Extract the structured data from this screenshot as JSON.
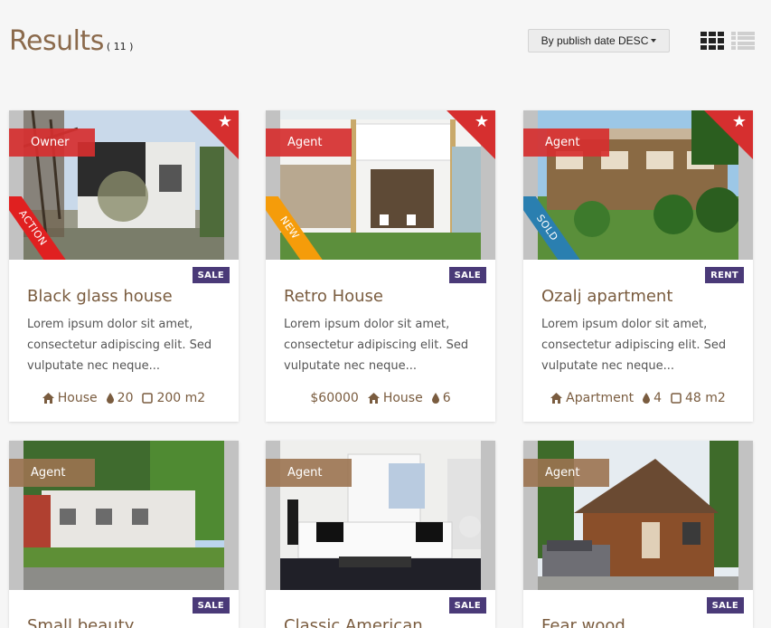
{
  "page": {
    "title": "Results",
    "count": "( 11 )",
    "sort_label": "By publish date DESC",
    "view_grid": "grid-view-icon",
    "view_list": "list-view-icon"
  },
  "colors": {
    "accent_brown": "#8b6a4c",
    "tag_red": "#d62f2f",
    "tag_brown": "#9b7350",
    "badge_purple": "#4a3a78",
    "ribbon_red": "#e02020",
    "ribbon_orange": "#f59c0a",
    "ribbon_blue": "#2a7fb0"
  },
  "listings": [
    {
      "tag": "Owner",
      "ribbon": "ACTION",
      "status": "SALE",
      "title": "Black glass house",
      "description": "Lorem ipsum dolor sit amet, consectetur adipiscing elit. Sed vulputate nec neque...",
      "meta": [
        {
          "icon": "home-icon",
          "value": "House"
        },
        {
          "icon": "drop-icon",
          "value": "20"
        },
        {
          "icon": "square-icon",
          "value": "200 m2"
        }
      ]
    },
    {
      "tag": "Agent",
      "ribbon": "NEW",
      "status": "SALE",
      "title": "Retro House",
      "description": "Lorem ipsum dolor sit amet, consectetur adipiscing elit. Sed vulputate nec neque...",
      "meta": [
        {
          "icon": "",
          "value": "$60000"
        },
        {
          "icon": "home-icon",
          "value": "House"
        },
        {
          "icon": "drop-icon",
          "value": "6"
        }
      ]
    },
    {
      "tag": "Agent",
      "ribbon": "SOLD",
      "status": "RENT",
      "title": "Ozalj apartment",
      "description": "Lorem ipsum dolor sit amet, consectetur adipiscing elit. Sed vulputate nec neque...",
      "meta": [
        {
          "icon": "home-icon",
          "value": "Apartment"
        },
        {
          "icon": "drop-icon",
          "value": "4"
        },
        {
          "icon": "square-icon",
          "value": "48 m2"
        }
      ]
    },
    {
      "tag": "Agent",
      "status": "SALE",
      "title": "Small beauty"
    },
    {
      "tag": "Agent",
      "status": "SALE",
      "title": "Classic American"
    },
    {
      "tag": "Agent",
      "status": "SALE",
      "title": "Fear wood"
    }
  ]
}
